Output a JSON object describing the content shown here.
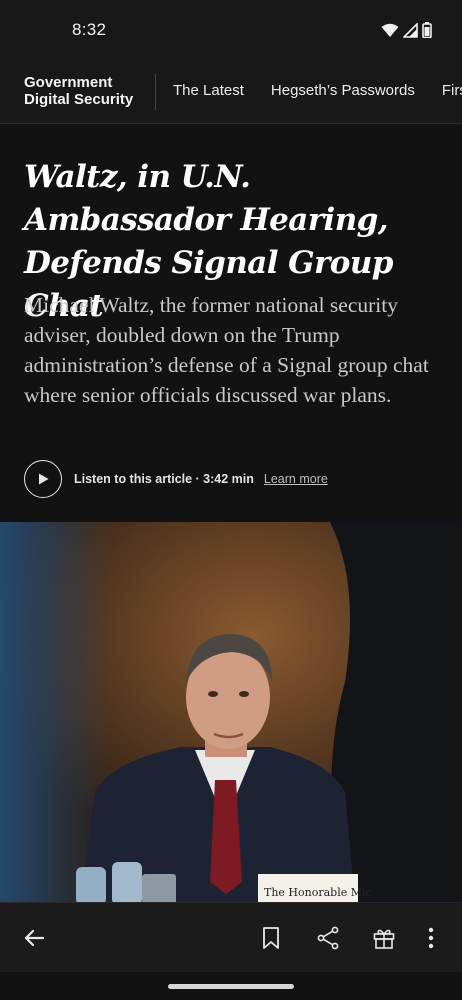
{
  "status_bar": {
    "time": "8:32",
    "icons": [
      "wifi-icon",
      "cellular-signal-icon",
      "battery-icon"
    ]
  },
  "section_nav": {
    "title": "Government Digital Security",
    "tabs": [
      "The Latest",
      "Hegseth’s Passwords",
      "First"
    ]
  },
  "article": {
    "headline": "Waltz, in U.N. Ambassador Hearing, Defends Signal Group Chat",
    "summary": "Michael Waltz, the former national security adviser, doubled down on the Trump administration’s defense of a Signal group chat where senior officials discussed war plans.",
    "audio": {
      "listen_label": "Listen to this article · 3:42 min",
      "learn_more": "Learn more"
    },
    "photo": {
      "nameplate_text": "The Honorable Mic"
    }
  },
  "toolbar": {
    "icons": [
      "back-arrow-icon",
      "bookmark-icon",
      "share-icon",
      "gift-icon",
      "more-vertical-icon"
    ]
  },
  "colors": {
    "background": "#121212",
    "bar": "#181818",
    "text_primary": "#ffffff",
    "text_secondary": "#c9c9c9"
  }
}
